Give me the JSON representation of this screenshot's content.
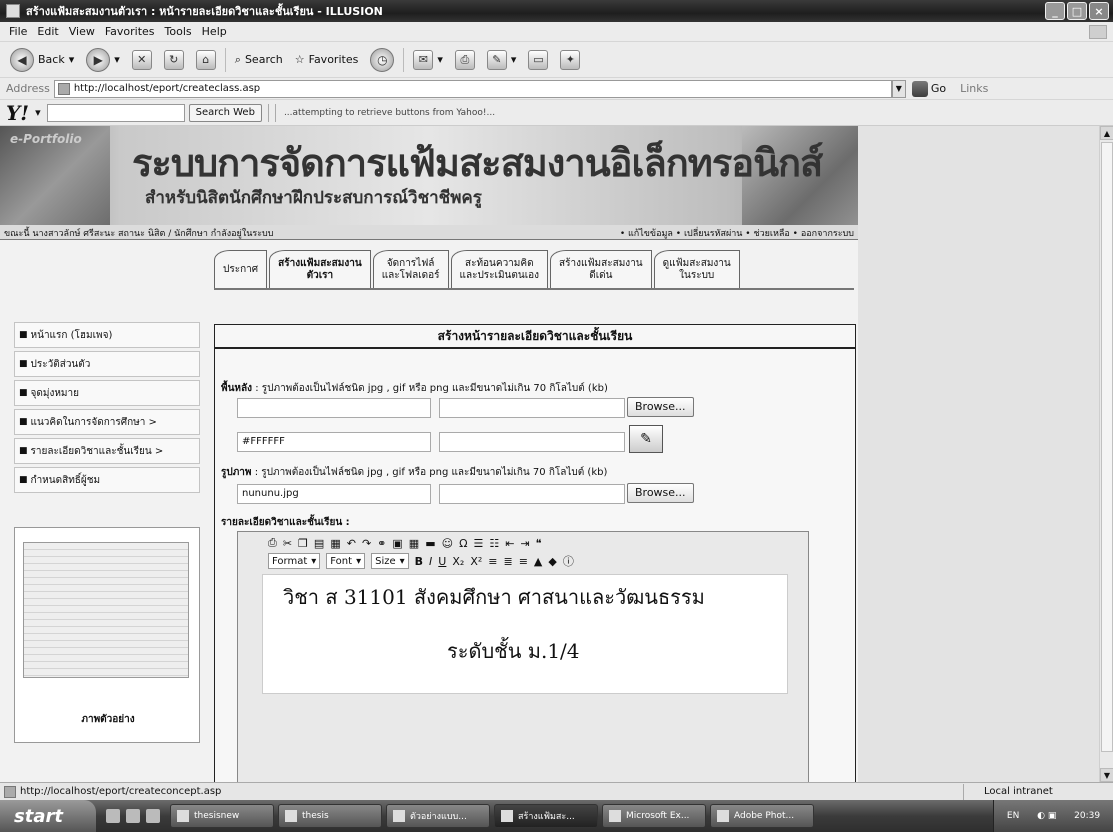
{
  "window": {
    "title": "สร้างแฟ้มสะสมงานตัวเรา : หน้ารายละเอียดวิชาและชั้นเรียน - ILLUSION"
  },
  "menu": [
    "File",
    "Edit",
    "View",
    "Favorites",
    "Tools",
    "Help"
  ],
  "toolbar": {
    "back": "Back",
    "search": "Search",
    "favorites": "Favorites"
  },
  "address": {
    "label": "Address",
    "url": "http://localhost/eport/createclass.asp",
    "go": "Go",
    "links": "Links"
  },
  "yahoo": {
    "logo": "Y!",
    "search_btn": "Search Web",
    "status": "...attempting to retrieve buttons from Yahoo!..."
  },
  "banner": {
    "brand": "e-Portfolio",
    "title": "ระบบการจัดการแฟ้มสะสมงานอิเล็กทรอนิกส์",
    "subtitle": "สำหรับนิสิตนักศึกษาฝึกประสบการณ์วิชาชีพครู",
    "user_line": "ขณะนี้ นางสาวลักษ์ ศรีสะนะ สถานะ นิสิต / นักศึกษา กำลังอยู่ในระบบ",
    "links": "• แก้ไขข้อมูล • เปลี่ยนรหัสผ่าน • ช่วยเหลือ • ออกจากระบบ"
  },
  "tabs": [
    {
      "label": "ประกาศ"
    },
    {
      "label": "สร้างแฟ้มสะสมงาน\nตัวเรา"
    },
    {
      "label": "จัดการไฟล์\nและโฟลเดอร์"
    },
    {
      "label": "สะท้อนความคิด\nและประเมินตนเอง"
    },
    {
      "label": "สร้างแฟ้มสะสมงาน\nดีเด่น"
    },
    {
      "label": "ดูแฟ้มสะสมงาน\nในระบบ"
    }
  ],
  "sidebar": {
    "items": [
      {
        "label": "หน้าแรก (โฮมเพจ)"
      },
      {
        "label": "ประวัติส่วนตัว"
      },
      {
        "label": "จุดมุ่งหมาย"
      },
      {
        "label": "แนวคิดในการจัดการศึกษา >"
      },
      {
        "label": "รายละเอียดวิชาและชั้นเรียน >"
      },
      {
        "label": "กำหนดสิทธิ์ผู้ชม"
      }
    ],
    "preview_caption": "ภาพตัวอย่าง"
  },
  "form": {
    "heading": "สร้างหน้ารายละเอียดวิชาและชั้นเรียน",
    "bg_label_bold": "พื้นหลัง",
    "bg_label_text": " : รูปภาพต้องเป็นไฟล์ชนิด jpg , gif หรือ png และมีขนาดไม่เกิน 70 กิโลไบต์ (kb)",
    "bg_file": "",
    "bg_color": "#FFFFFF",
    "img_label_bold": "รูปภาพ",
    "img_label_text": " : รูปภาพต้องเป็นไฟล์ชนิด jpg , gif หรือ png และมีขนาดไม่เกิน 70 กิโลไบต์ (kb)",
    "img_file": "nununu.jpg",
    "browse": "Browse...",
    "detail_label": "รายละเอียดวิชาและชั้นเรียน :"
  },
  "editor": {
    "format": "Format",
    "font": "Font",
    "size": "Size",
    "line1": "วิชา ส 31101 สังคมศึกษา ศาสนาและวัฒนธรรม",
    "line2": "ระดับชั้น ม.1/4"
  },
  "status": {
    "url": "http://localhost/eport/createconcept.asp",
    "zone": "Local intranet"
  },
  "taskbar": {
    "start": "start",
    "tasks": [
      "thesisnew",
      "thesis",
      "ตัวอย่างแบบ...",
      "สร้างแฟ้มสะ...",
      "Microsoft Ex...",
      "Adobe Phot..."
    ],
    "lang": "EN",
    "time": "20:39"
  }
}
